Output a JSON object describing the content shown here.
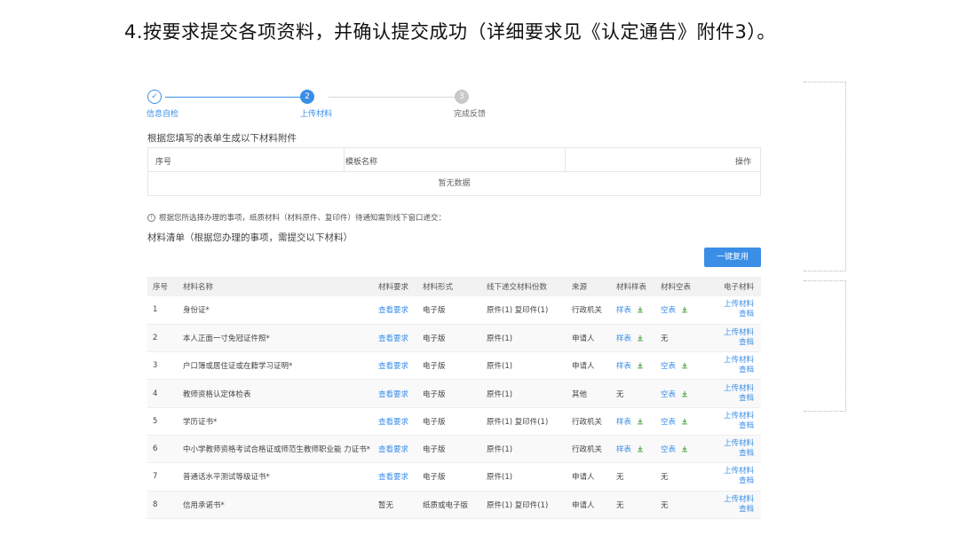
{
  "heading": "4.按要求提交各项资料，并确认提交成功（详细要求见《认定通告》附件3）。",
  "steps": [
    {
      "num": "✓",
      "label": "信息自检",
      "state": "done"
    },
    {
      "num": "2",
      "label": "上传材料",
      "state": "active"
    },
    {
      "num": "3",
      "label": "完成反馈",
      "state": "todo"
    }
  ],
  "template_section": {
    "title": "根据您填写的表单生成以下材料附件",
    "columns": [
      "序号",
      "模板名称",
      "操作"
    ],
    "empty_text": "暂无数据"
  },
  "notice": "根据您所选择办理的事项，纸质材料（材料原件、复印件）待通知需到线下窗口递交：",
  "materials_section": {
    "title": "材料清单（根据您办理的事项，需提交以下材料）",
    "copy_button": "一键复用",
    "columns": [
      "序号",
      "材料名称",
      "材料要求",
      "材料形式",
      "线下递交材料份数",
      "来源",
      "材料样表",
      "材料空表",
      "电子材料"
    ],
    "upload_label": "上传材料",
    "view_label": "查档",
    "rows": [
      {
        "no": "1",
        "name": "身份证*",
        "req": "查看要求",
        "form": "电子版",
        "copies": "原件(1) 复印件(1)",
        "source": "行政机关",
        "sample": "样表",
        "blank": "空表"
      },
      {
        "no": "2",
        "name": "本人正面一寸免冠证件照*",
        "req": "查看要求",
        "form": "电子版",
        "copies": "原件(1)",
        "source": "申请人",
        "sample": "样表",
        "blank": "无"
      },
      {
        "no": "3",
        "name": "户口簿或居住证或在籍学习证明*",
        "req": "查看要求",
        "form": "电子版",
        "copies": "原件(1)",
        "source": "申请人",
        "sample": "样表",
        "blank": "空表"
      },
      {
        "no": "4",
        "name": "教师资格认定体检表",
        "req": "查看要求",
        "form": "电子版",
        "copies": "原件(1)",
        "source": "其他",
        "sample": "无",
        "blank": "空表"
      },
      {
        "no": "5",
        "name": "学历证书*",
        "req": "查看要求",
        "form": "电子版",
        "copies": "原件(1) 复印件(1)",
        "source": "行政机关",
        "sample": "样表",
        "blank": "空表"
      },
      {
        "no": "6",
        "name": "中小学教师资格考试合格证或师范生教师职业能 力证书*",
        "req": "查看要求",
        "form": "电子版",
        "copies": "原件(1)",
        "source": "行政机关",
        "sample": "样表",
        "blank": "空表"
      },
      {
        "no": "7",
        "name": "普通话水平测试等级证书*",
        "req": "查看要求",
        "form": "电子版",
        "copies": "原件(1)",
        "source": "申请人",
        "sample": "无",
        "blank": "无"
      },
      {
        "no": "8",
        "name": "信用承诺书*",
        "req": "暂无",
        "form": "纸质或电子版",
        "copies": "原件(1) 复印件(1)",
        "source": "申请人",
        "sample": "无",
        "blank": "无"
      }
    ]
  },
  "colors": {
    "accent": "#3a8ee6",
    "download": "#52a447"
  }
}
